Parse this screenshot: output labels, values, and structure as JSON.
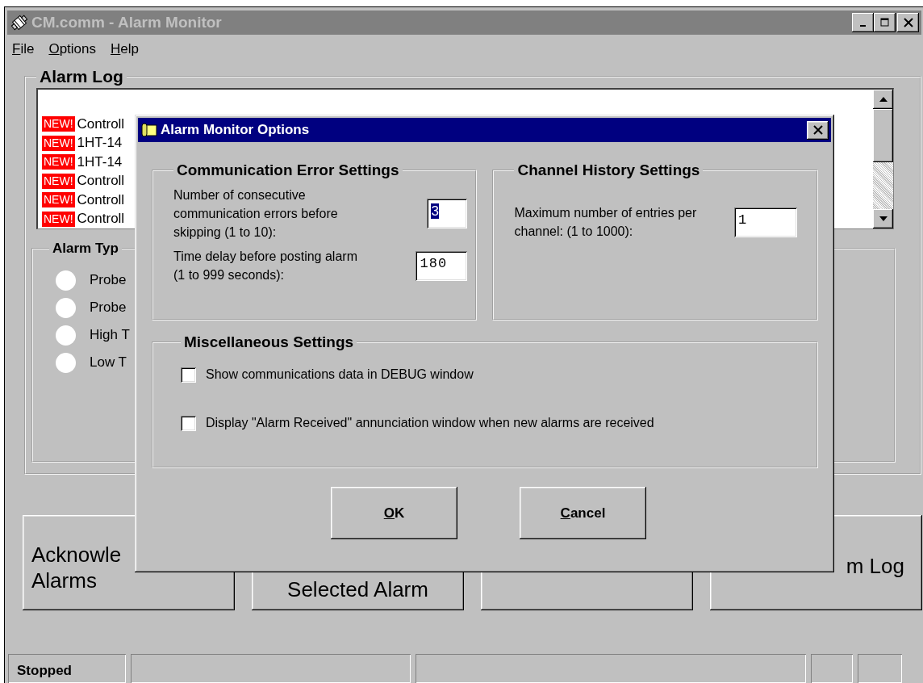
{
  "window": {
    "title": "CM.comm - Alarm Monitor",
    "active": false
  },
  "menu": [
    {
      "label": "File"
    },
    {
      "label": "Options"
    },
    {
      "label": "Help"
    }
  ],
  "alarm_log": {
    "title": "Alarm Log",
    "rows": [
      {
        "badge": "NEW!",
        "text": "Controll"
      },
      {
        "badge": "NEW!",
        "text": "1HT-14"
      },
      {
        "badge": "NEW!",
        "text": "1HT-14"
      },
      {
        "badge": "NEW!",
        "text": "Controll"
      },
      {
        "badge": "NEW!",
        "text": "Controll"
      },
      {
        "badge": "NEW!",
        "text": "Controll"
      }
    ]
  },
  "alarm_type": {
    "title": "Alarm Typ",
    "options": [
      {
        "label": "Probe",
        "selected": false
      },
      {
        "label": "Probe",
        "selected": false
      },
      {
        "label": "High T",
        "selected": false
      },
      {
        "label": "Low T",
        "selected": false
      }
    ]
  },
  "buttons": [
    {
      "kind": "label",
      "lines": [
        "Acknowle",
        "Alarms"
      ]
    },
    {
      "kind": "label",
      "lines": [
        "Selected Alarm"
      ]
    },
    {
      "kind": "blank"
    },
    {
      "kind": "label",
      "lines": [
        "m Log"
      ]
    }
  ],
  "status_bar": {
    "text": "Stopped"
  },
  "dialog": {
    "title": "Alarm Monitor Options",
    "comm": {
      "title": "Communication Error Settings",
      "fields": [
        {
          "label": "Number of consecutive communication errors before skipping (1 to 10):",
          "value": "3",
          "text_selected": true
        },
        {
          "label": "Time delay before posting alarm (1 to 999 seconds):",
          "value": "180",
          "text_selected": false
        }
      ]
    },
    "history": {
      "title": "Channel History Settings",
      "fields": [
        {
          "label": "Maximum number of entries per channel: (1 to 1000):",
          "value": "1",
          "text_selected": false
        }
      ]
    },
    "misc": {
      "title": "Miscellaneous Settings",
      "options": [
        {
          "label": "Show communications data in DEBUG window",
          "checked": false
        },
        {
          "label": "Display \"Alarm Received\" annunciation window when new alarms are received",
          "checked": false
        }
      ]
    },
    "buttons": [
      {
        "label": "OK"
      },
      {
        "label": "Cancel"
      }
    ]
  }
}
